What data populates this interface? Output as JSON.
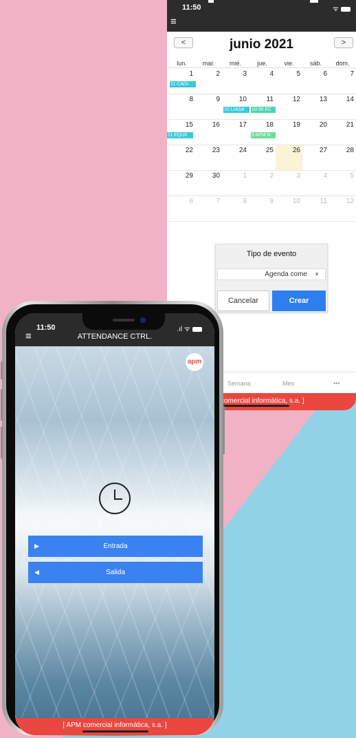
{
  "calendar_app": {
    "status_time": "11:50",
    "month_title": "junio 2021",
    "prev_label": "<",
    "next_label": ">",
    "weekdays": [
      "lun.",
      "mar.",
      "mié.",
      "jue.",
      "vie.",
      "sáb.",
      "dom."
    ],
    "weeks": [
      [
        "1",
        "2",
        "3",
        "4",
        "5",
        "6",
        "7"
      ],
      [
        "8",
        "9",
        "10",
        "11",
        "12",
        "13",
        "14"
      ],
      [
        "15",
        "16",
        "17",
        "18",
        "19",
        "20",
        "21"
      ],
      [
        "22",
        "23",
        "24",
        "25",
        "26",
        "27",
        "28"
      ],
      [
        "29",
        "30",
        "1",
        "2",
        "3",
        "4",
        "5"
      ],
      [
        "6",
        "7",
        "8",
        "9",
        "10",
        "11",
        "12"
      ]
    ],
    "events": [
      {
        "label": "11 CADI",
        "color": "#3cc8d8"
      },
      {
        "label": "10 LIASA",
        "color": "#3cc8d8"
      },
      {
        "label": "10:30 FC",
        "color": "#4fd3b0"
      },
      {
        "label": "11 EQUII",
        "color": "#3cc8d8"
      },
      {
        "label": "9 APM N",
        "color": "#6fdc9a"
      }
    ],
    "dialog": {
      "title": "Tipo de evento",
      "select_value": "Agenda come",
      "cancel_label": "Cancelar",
      "create_label": "Crear"
    },
    "tabs": [
      "Semana",
      "Mes",
      "•••"
    ],
    "footer": "comercial informàtica, s.a. ]"
  },
  "attendance_app": {
    "status_time": "11:50",
    "title": "ATTENDANCE CTRL.",
    "logo_text": "apm",
    "entrada_label": "Entrada",
    "salida_label": "Salida",
    "footer": "[ APM comercial informàtica, s.a. ]"
  },
  "colors": {
    "background_pink": "#f2b2c6",
    "background_blue": "#92d2e7",
    "accent_blue": "#3a82ef",
    "footer_red": "#e9473f"
  }
}
